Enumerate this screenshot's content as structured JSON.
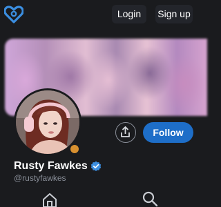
{
  "header": {
    "logo_icon": "heart-lock-icon",
    "login_label": "Login",
    "signup_label": "Sign up",
    "accent_color": "#3b8ee0"
  },
  "profile": {
    "cover_icon": "blurred-cover-image",
    "avatar_icon": "profile-avatar",
    "display_name": "Rusty Fawkes",
    "verified_icon": "verified-badge-icon",
    "username": "@rustyfawkes",
    "share_icon": "share-icon",
    "follow_label": "Follow",
    "follow_color": "#1e6ec8"
  },
  "nav": {
    "items": [
      {
        "icon": "home-icon"
      },
      {
        "icon": "search-icon"
      }
    ]
  }
}
